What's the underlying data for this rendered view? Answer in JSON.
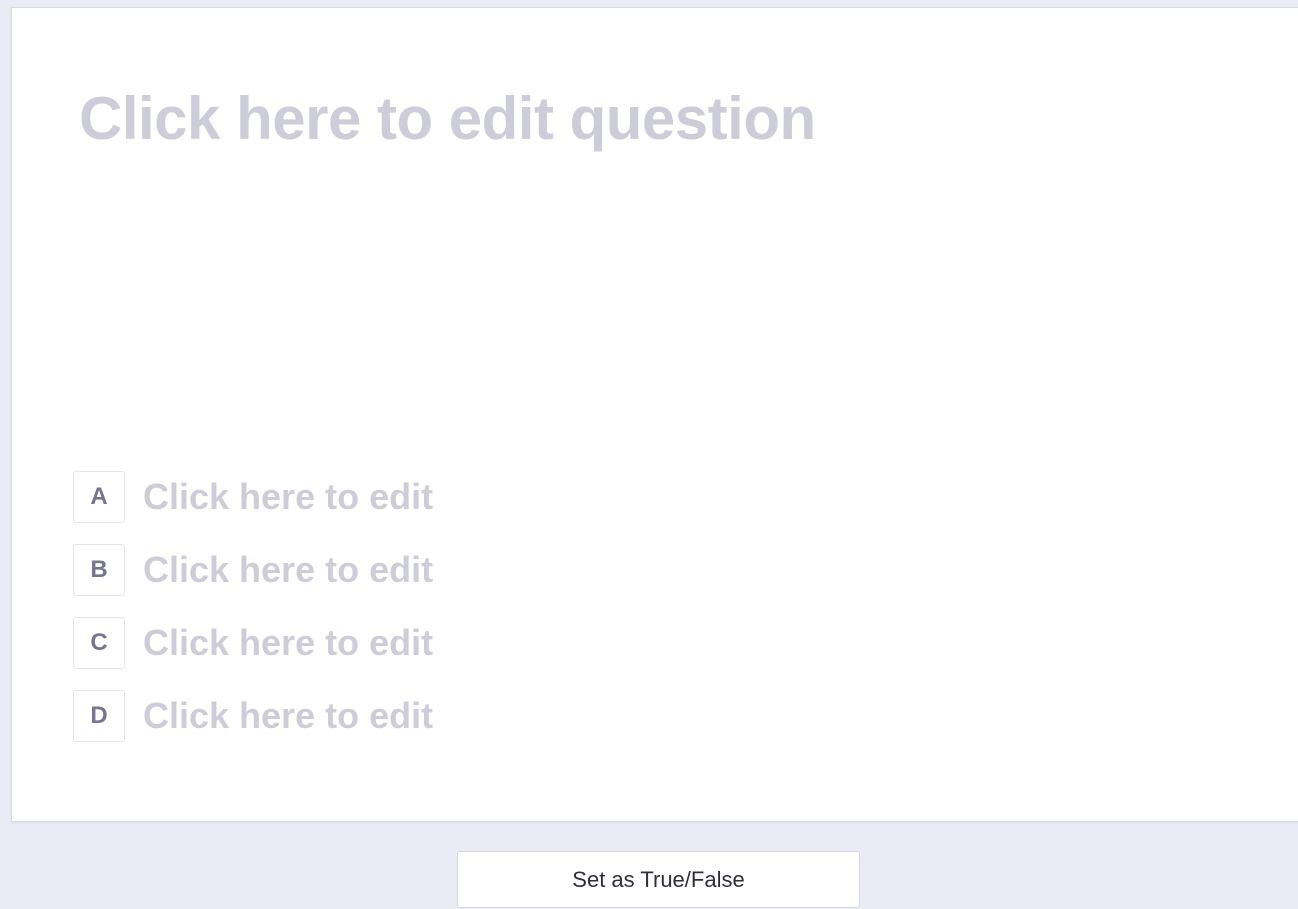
{
  "question": {
    "placeholder": "Click here to edit question"
  },
  "answers": [
    {
      "letter": "A",
      "text": "Click here to edit"
    },
    {
      "letter": "B",
      "text": "Click here to edit"
    },
    {
      "letter": "C",
      "text": "Click here to edit"
    },
    {
      "letter": "D",
      "text": "Click here to edit"
    }
  ],
  "footer": {
    "true_false_label": "Set as True/False"
  },
  "colors": {
    "background": "#ebebf5",
    "placeholder_text": "#cdccd9",
    "letter_text": "#767690",
    "button_text": "#2f2f3a"
  }
}
